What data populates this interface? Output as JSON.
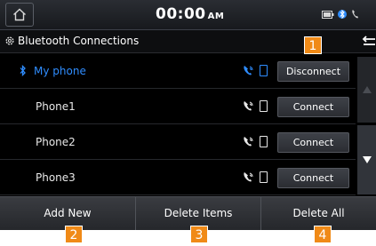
{
  "status_bar": {
    "time": "00:00",
    "ampm": "AM",
    "icons": [
      "home-icon",
      "battery-icon",
      "bluetooth-icon",
      "call-icon"
    ]
  },
  "header": {
    "title": "Bluetooth Connections",
    "icons": [
      "gear-icon",
      "back-icon"
    ]
  },
  "devices": [
    {
      "name": "My phone",
      "action": "Disconnect",
      "connected": true
    },
    {
      "name": "Phone1",
      "action": "Connect",
      "connected": false
    },
    {
      "name": "Phone2",
      "action": "Connect",
      "connected": false
    },
    {
      "name": "Phone3",
      "action": "Connect",
      "connected": false
    }
  ],
  "bottom_buttons": {
    "add_new": "Add New",
    "delete_items": "Delete Items",
    "delete_all": "Delete All"
  },
  "callouts": [
    "1",
    "2",
    "3",
    "4"
  ],
  "colors": {
    "accent": "#2f8dff",
    "callout": "#f08a17",
    "background": "#000000"
  }
}
